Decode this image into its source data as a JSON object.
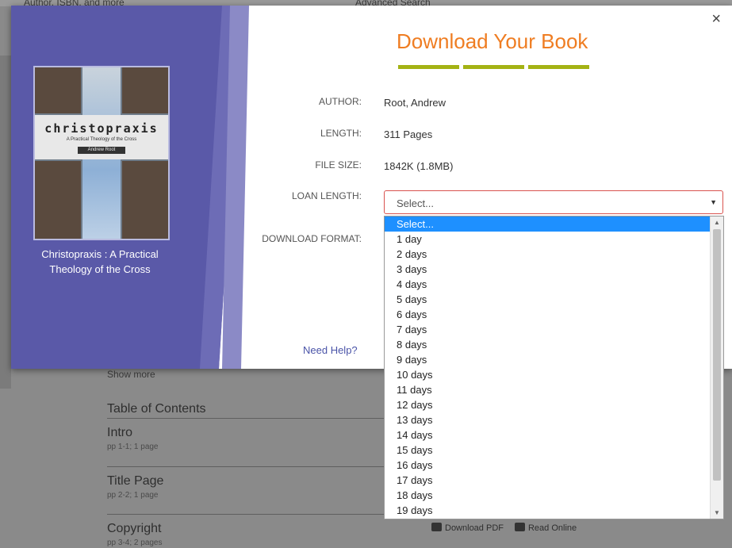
{
  "modal": {
    "close_symbol": "×",
    "heading": "Download Your Book",
    "accent_color": "#ef7d22",
    "book": {
      "cover_title": "christopraxis",
      "cover_subtitle": "A Practical Theology of the Cross",
      "cover_author": "Andrew Root",
      "title": "Christopraxis : A Practical Theology of the Cross"
    },
    "fields": {
      "author_label": "AUTHOR:",
      "author_value": "Root, Andrew",
      "length_label": "LENGTH:",
      "length_value": "311 Pages",
      "filesize_label": "FILE SIZE:",
      "filesize_value": "1842K (1.8MB)",
      "loan_label": "LOAN LENGTH:",
      "loan_selected": "Select...",
      "format_label": "DOWNLOAD FORMAT:"
    },
    "help_link": "Need Help?",
    "loan_options": [
      "Select...",
      "1 day",
      "2 days",
      "3 days",
      "4 days",
      "5 days",
      "6 days",
      "7 days",
      "8 days",
      "9 days",
      "10 days",
      "11 days",
      "12 days",
      "13 days",
      "14 days",
      "15 days",
      "16 days",
      "17 days",
      "18 days",
      "19 days"
    ]
  },
  "background": {
    "top_left_text": "Author, ISBN, and more",
    "advanced_search": "Advanced Search",
    "show_more": "Show more",
    "toc_heading": "Table of Contents",
    "toc": [
      {
        "title": "Intro",
        "pages": "pp 1-1; 1 page"
      },
      {
        "title": "Title Page",
        "pages": "pp 2-2; 1 page"
      },
      {
        "title": "Copyright",
        "pages": "pp 3-4; 2 pages"
      }
    ],
    "download_pdf": "Download PDF",
    "read_online": "Read Online"
  }
}
